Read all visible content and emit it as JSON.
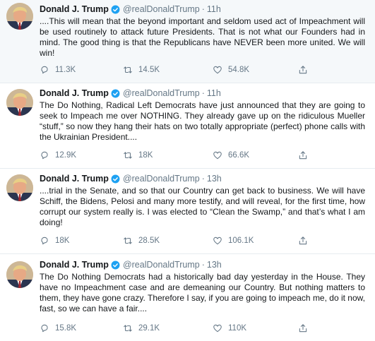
{
  "tweets": [
    {
      "name": "Donald J. Trump",
      "handle": "@realDonaldTrump",
      "separator": "·",
      "time": "11h",
      "text": "....This will mean that the beyond important and seldom used act of Impeachment will be used routinely to attack future Presidents. That is not what our Founders had in mind. The good thing is that the Republicans have NEVER been more united. We will win!",
      "replies": "11.3K",
      "retweets": "14.5K",
      "likes": "54.8K"
    },
    {
      "name": "Donald J. Trump",
      "handle": "@realDonaldTrump",
      "separator": "·",
      "time": "11h",
      "text": "The Do Nothing, Radical Left Democrats have just announced that they are going to seek to Impeach me over NOTHING. They already gave up on the ridiculous Mueller “stuff,” so now they hang their hats on two totally appropriate (perfect) phone calls with the Ukrainian President....",
      "replies": "12.9K",
      "retweets": "18K",
      "likes": "66.6K"
    },
    {
      "name": "Donald J. Trump",
      "handle": "@realDonaldTrump",
      "separator": "·",
      "time": "13h",
      "text": "....trial in the Senate, and so that our Country can get back to business. We will have Schiff, the Bidens, Pelosi and many more testify, and will reveal, for the first time, how corrupt our system really is. I was elected to “Clean the Swamp,” and that’s what I am doing!",
      "replies": "18K",
      "retweets": "28.5K",
      "likes": "106.1K"
    },
    {
      "name": "Donald J. Trump",
      "handle": "@realDonaldTrump",
      "separator": "·",
      "time": "13h",
      "text": "The Do Nothing Democrats had a historically bad day yesterday in the House. They have no Impeachment case and are demeaning our Country. But nothing matters to them, they have gone crazy. Therefore I say, if you are going to impeach me, do it now, fast, so we can have a fair....",
      "replies": "15.8K",
      "retweets": "29.1K",
      "likes": "110K"
    }
  ],
  "icons": {
    "reply": "reply-icon",
    "retweet": "retweet-icon",
    "like": "heart-icon",
    "share": "share-icon",
    "verified": "verified-badge-icon"
  },
  "colors": {
    "verified": "#1da1f2",
    "muted": "#657786",
    "text": "#14171a",
    "highlight_bg": "#f5f8fa",
    "divider": "#e6ecf0"
  }
}
